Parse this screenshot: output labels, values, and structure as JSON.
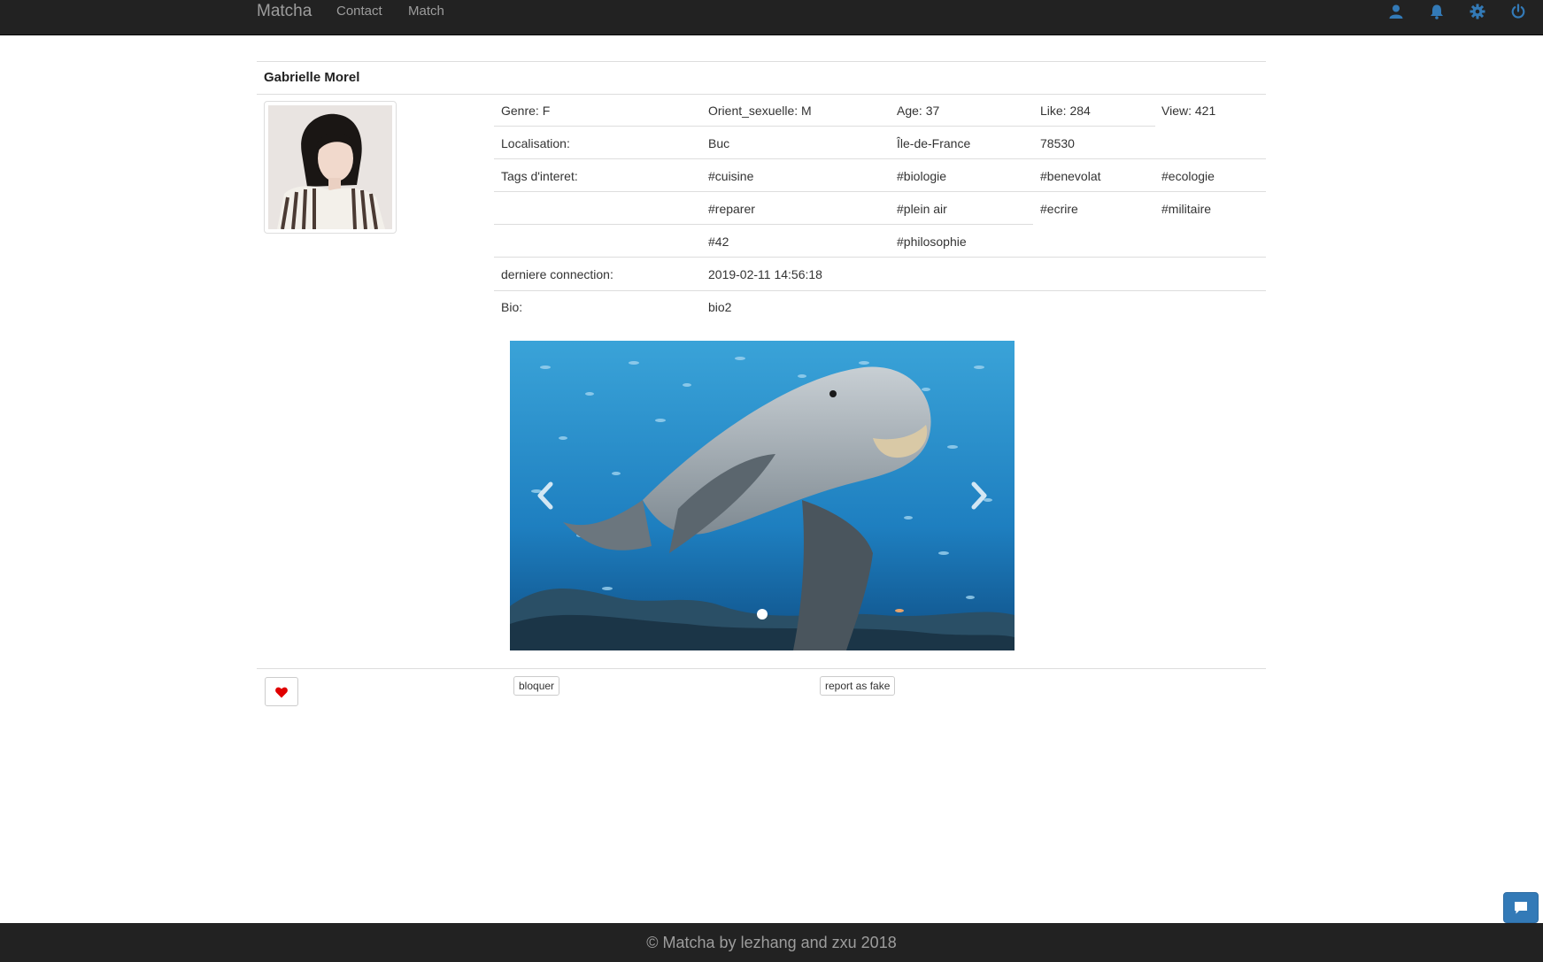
{
  "navbar": {
    "brand": "Matcha",
    "links": [
      "Contact",
      "Match"
    ],
    "icons": [
      "user-icon",
      "bell-icon",
      "gear-icon",
      "power-icon"
    ],
    "accent": "#337ab7"
  },
  "profile": {
    "name": "Gabrielle Morel",
    "genre": "Genre: F",
    "orientation": "Orient_sexuelle: M",
    "age": "Age: 37",
    "like": "Like: 284",
    "view": "View: 421",
    "location_label": "Localisation:",
    "city": "Buc",
    "region": "Île-de-France",
    "postcode": "78530",
    "tags_label": "Tags d'interet:",
    "tags": [
      "#cuisine",
      "#biologie",
      "#benevolat",
      "#ecologie",
      "#reparer",
      "#plein air",
      "#ecrire",
      "#militaire",
      "#42",
      "#philosophie"
    ],
    "last_connection_label": "derniere connection:",
    "last_connection": "2019-02-11 14:56:18",
    "bio_label": "Bio:",
    "bio": "bio2"
  },
  "carousel": {
    "slide_count": 1,
    "active_index": 0
  },
  "actions": {
    "like_icon": "heart-icon",
    "block_label": "bloquer",
    "report_label": "report as fake",
    "heart_color": "#e00000"
  },
  "chat": {
    "icon": "chat-icon"
  },
  "footer": {
    "text": "© Matcha by lezhang and zxu 2018"
  }
}
